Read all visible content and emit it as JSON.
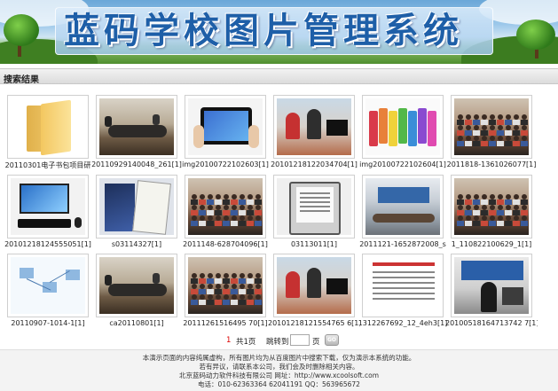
{
  "banner": {
    "title": "蓝码学校图片管理系统"
  },
  "section": {
    "title": "搜索结果"
  },
  "images": [
    {
      "name": "20110301电子书包项目研",
      "kind": "folder"
    },
    {
      "name": "20110929140048_261[1]",
      "kind": "meeting"
    },
    {
      "name": "img20100722102603[1]",
      "kind": "tablet"
    },
    {
      "name": "20101218122034704[1]",
      "kind": "students"
    },
    {
      "name": "img20100722102604[1]",
      "kind": "colors"
    },
    {
      "name": "2011818-1361026077[1]",
      "kind": "group"
    },
    {
      "name": "20101218124555051[1]",
      "kind": "computer"
    },
    {
      "name": "s03114327[1]",
      "kind": "ereader"
    },
    {
      "name": "2011148-628704096[1]",
      "kind": "group"
    },
    {
      "name": "03113011[1]",
      "kind": "ebook"
    },
    {
      "name": "2011121-1652872008_s",
      "kind": "meeting2"
    },
    {
      "name": "1_110822100629_1[1]",
      "kind": "group"
    },
    {
      "name": "20110907-1014-1[1]",
      "kind": "diagram"
    },
    {
      "name": "ca20110801[1]",
      "kind": "meeting"
    },
    {
      "name": "20111261516495 70[1]",
      "kind": "group"
    },
    {
      "name": "20101218121554765 6[1]",
      "kind": "students"
    },
    {
      "name": "1312267692_12_4eh3[1]",
      "kind": "document"
    },
    {
      "name": "20100518164713742 7[1]",
      "kind": "presenter"
    }
  ],
  "pager": {
    "current": "1",
    "total": "共1页",
    "jump": "跳转到",
    "unit": "页",
    "go": "GO"
  },
  "footer": {
    "line1": "本演示页面的内容纯属虚构，所有图片均为从百度图片中搜索下载，仅为演示本系统的功能。",
    "line2": "若有异议，请联系本公司，我们会及时删除相关内容。",
    "line3": "北京蓝码动力软件科技有限公司 网址：http://www.xcoolsoft.com",
    "line4": "电话：010-62363364 62041191 QQ：563965672"
  }
}
